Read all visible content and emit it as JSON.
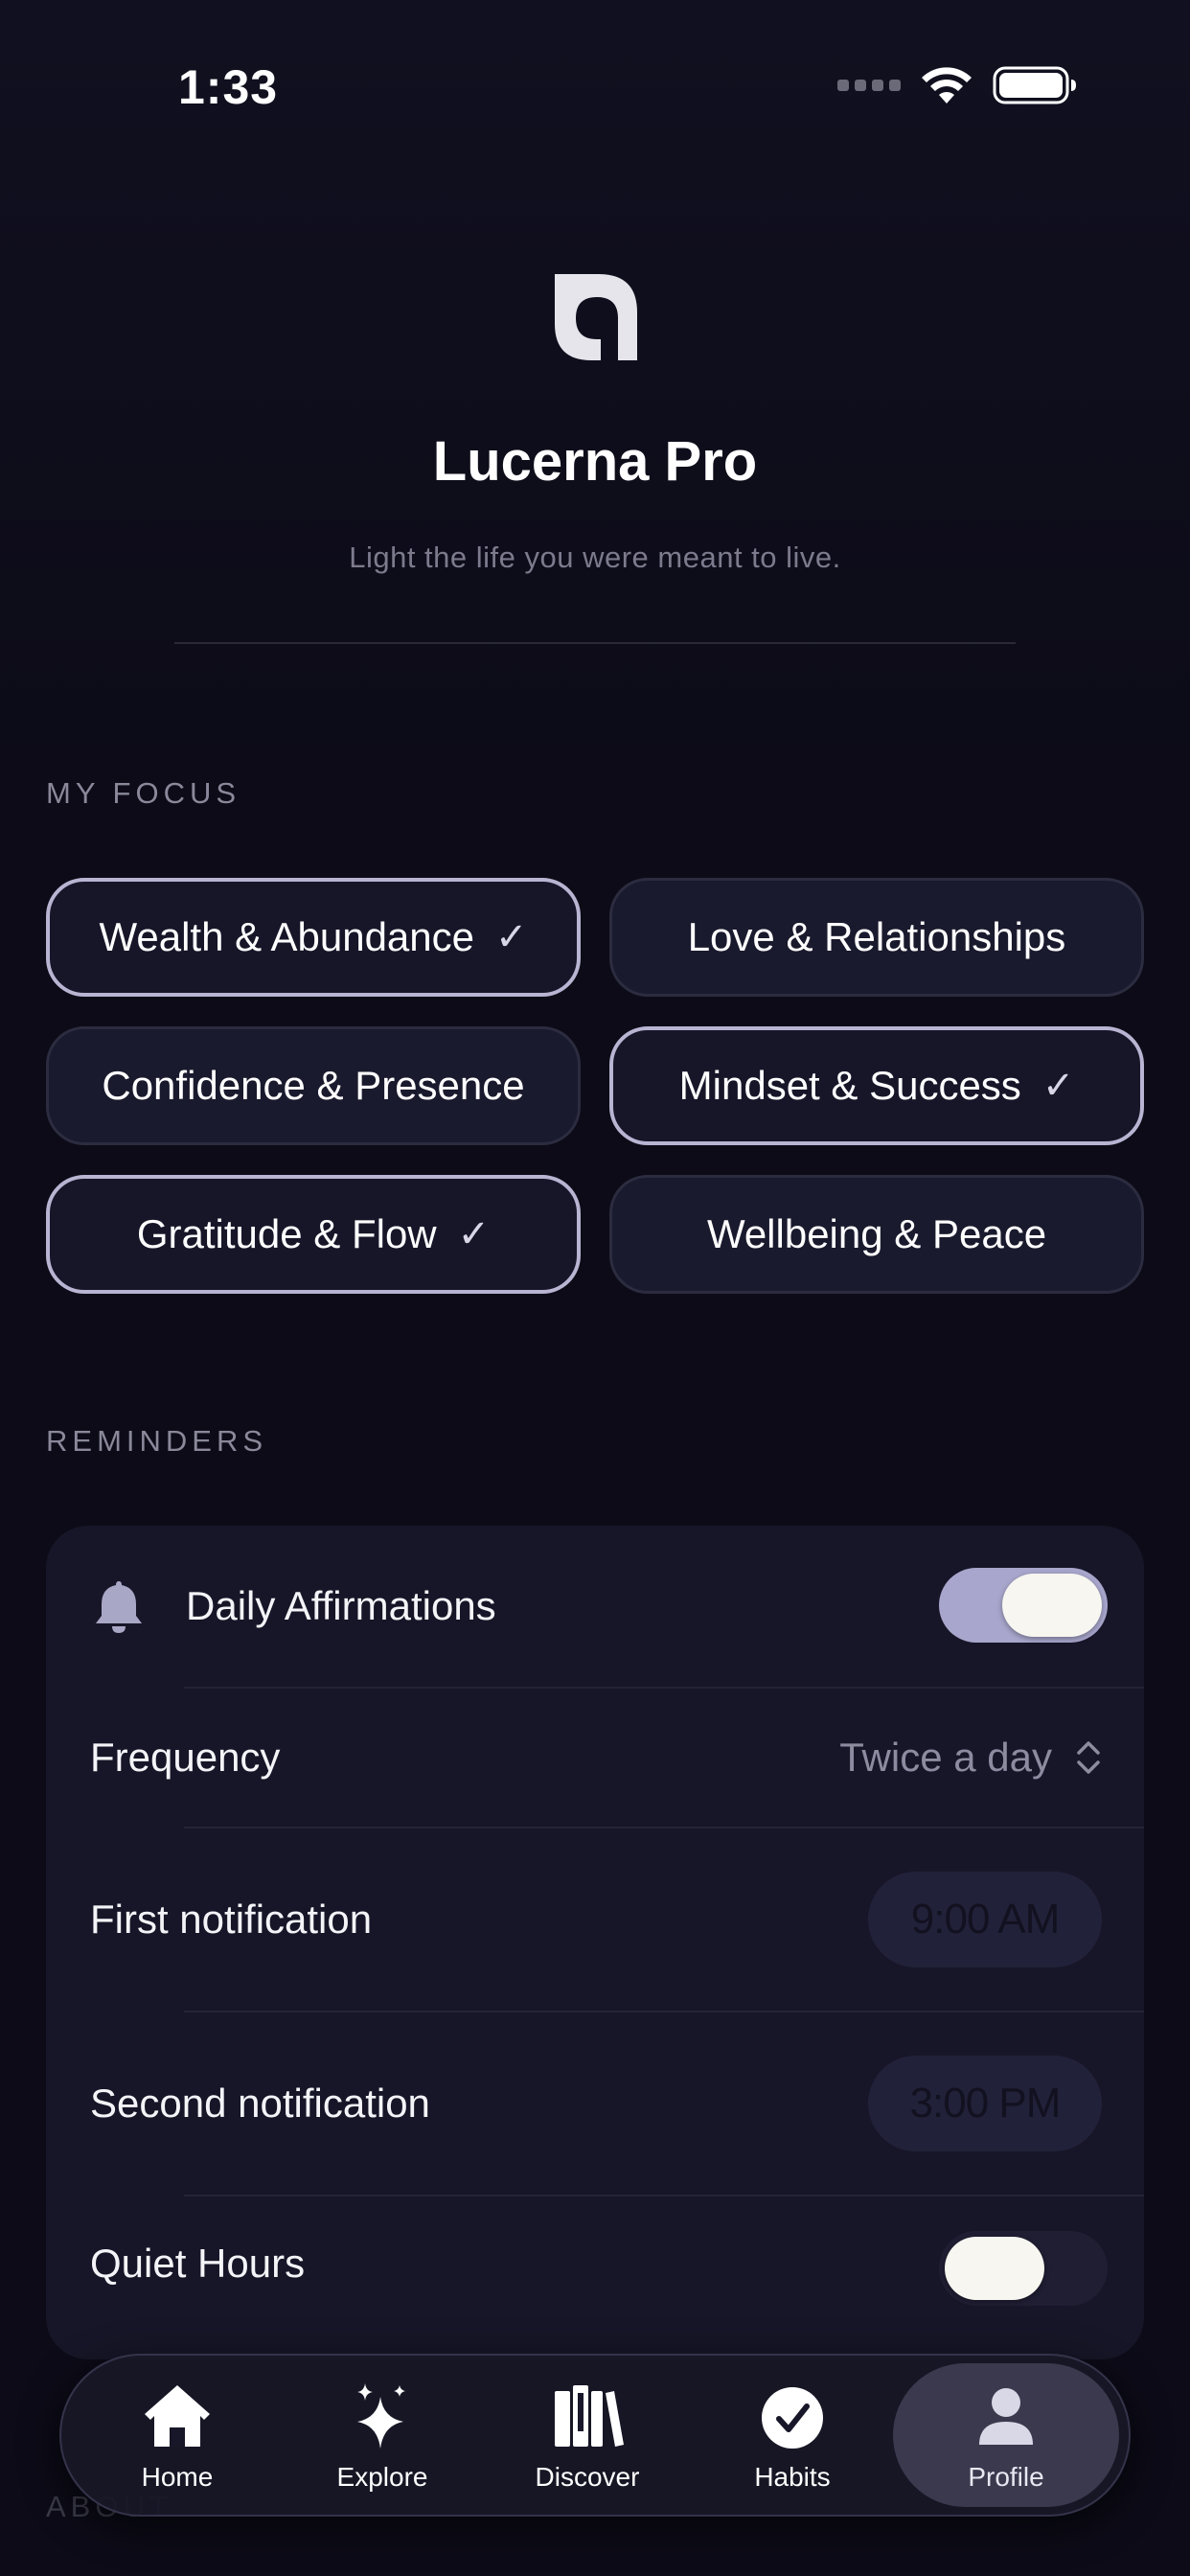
{
  "status_bar": {
    "time": "1:33"
  },
  "header": {
    "app_name": "Lucerna Pro",
    "tagline": "Light the life you were meant to live."
  },
  "focus": {
    "section_label": "MY FOCUS",
    "chips": [
      {
        "label": "Wealth & Abundance",
        "selected": true,
        "check": "✓"
      },
      {
        "label": "Love & Relationships",
        "selected": false,
        "check": ""
      },
      {
        "label": "Confidence & Presence",
        "selected": false,
        "check": ""
      },
      {
        "label": "Mindset & Success",
        "selected": true,
        "check": "✓"
      },
      {
        "label": "Gratitude & Flow",
        "selected": true,
        "check": "✓"
      },
      {
        "label": "Wellbeing & Peace",
        "selected": false,
        "check": ""
      }
    ]
  },
  "reminders": {
    "section_label": "REMINDERS",
    "daily_affirmations": {
      "label": "Daily Affirmations",
      "enabled": true
    },
    "frequency": {
      "label": "Frequency",
      "value": "Twice a day"
    },
    "first_notification": {
      "label": "First notification",
      "time": "9:00 AM"
    },
    "second_notification": {
      "label": "Second notification",
      "time": "3:00 PM"
    },
    "quiet_hours": {
      "label": "Quiet Hours",
      "enabled": false
    }
  },
  "next_section_peek": "ABOUT",
  "tab_bar": {
    "active": "Profile",
    "tabs": [
      {
        "label": "Home",
        "icon": "house-icon"
      },
      {
        "label": "Explore",
        "icon": "sparkles-icon"
      },
      {
        "label": "Discover",
        "icon": "books-icon"
      },
      {
        "label": "Habits",
        "icon": "checkmark-circle-icon"
      },
      {
        "label": "Profile",
        "icon": "person-icon"
      }
    ]
  },
  "colors": {
    "background": "#0c0b17",
    "card": "#171628",
    "accent": "#a8a6cc",
    "chip_selected_border": "#b8b4d2",
    "secondary_text": "#8d8ba0"
  }
}
